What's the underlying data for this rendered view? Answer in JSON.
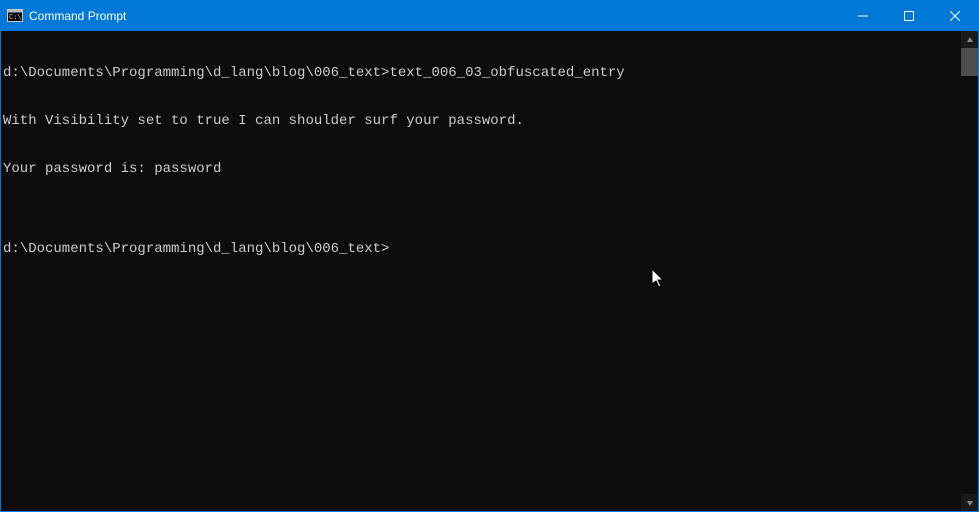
{
  "titlebar": {
    "title": "Command Prompt"
  },
  "terminal": {
    "lines": [
      "d:\\Documents\\Programming\\d_lang\\blog\\006_text>text_006_03_obfuscated_entry",
      "With Visibility set to true I can shoulder surf your password.",
      "Your password is: password",
      "",
      "d:\\Documents\\Programming\\d_lang\\blog\\006_text>"
    ]
  }
}
